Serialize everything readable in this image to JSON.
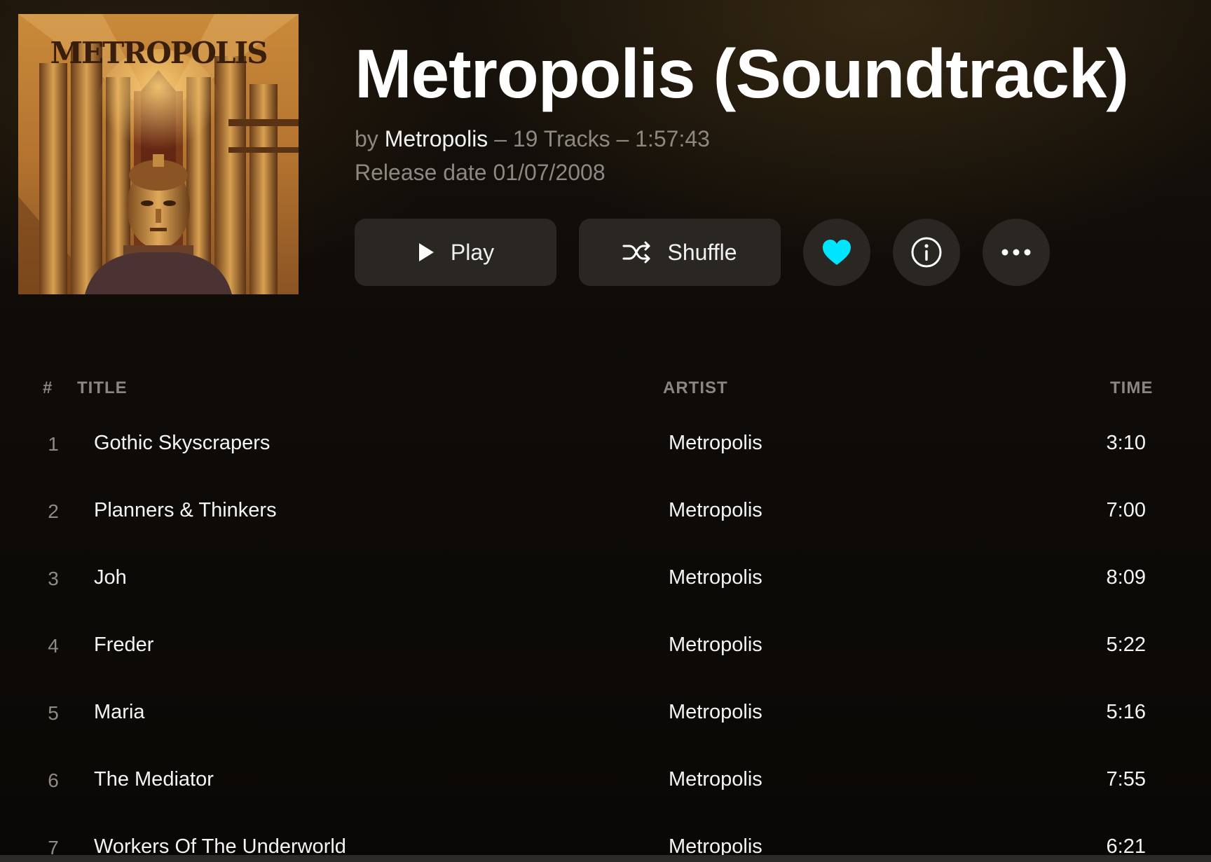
{
  "album": {
    "title": "Metropolis (Soundtrack)",
    "by_prefix": "by",
    "artist": "Metropolis",
    "details": "– 19 Tracks – 1:57:43",
    "release": "Release date 01/07/2008",
    "cover_text": "METROPOLIS"
  },
  "actions": {
    "play_label": "Play",
    "shuffle_label": "Shuffle",
    "play_icon": "play-icon",
    "shuffle_icon": "shuffle-icon",
    "favorite_icon": "heart-icon",
    "favorite_color": "#00e5ff",
    "info_icon": "info-icon",
    "more_icon": "more-icon"
  },
  "table": {
    "headers": {
      "num": "#",
      "title": "TITLE",
      "artist": "ARTIST",
      "time": "TIME"
    },
    "tracks": [
      {
        "num": "1",
        "title": "Gothic Skyscrapers",
        "artist": "Metropolis",
        "time": "3:10"
      },
      {
        "num": "2",
        "title": "Planners & Thinkers",
        "artist": "Metropolis",
        "time": "7:00"
      },
      {
        "num": "3",
        "title": "Joh",
        "artist": "Metropolis",
        "time": "8:09"
      },
      {
        "num": "4",
        "title": "Freder",
        "artist": "Metropolis",
        "time": "5:22"
      },
      {
        "num": "5",
        "title": "Maria",
        "artist": "Metropolis",
        "time": "5:16"
      },
      {
        "num": "6",
        "title": "The Mediator",
        "artist": "Metropolis",
        "time": "7:55"
      },
      {
        "num": "7",
        "title": "Workers Of The Underworld",
        "artist": "Metropolis",
        "time": "6:21"
      }
    ]
  }
}
